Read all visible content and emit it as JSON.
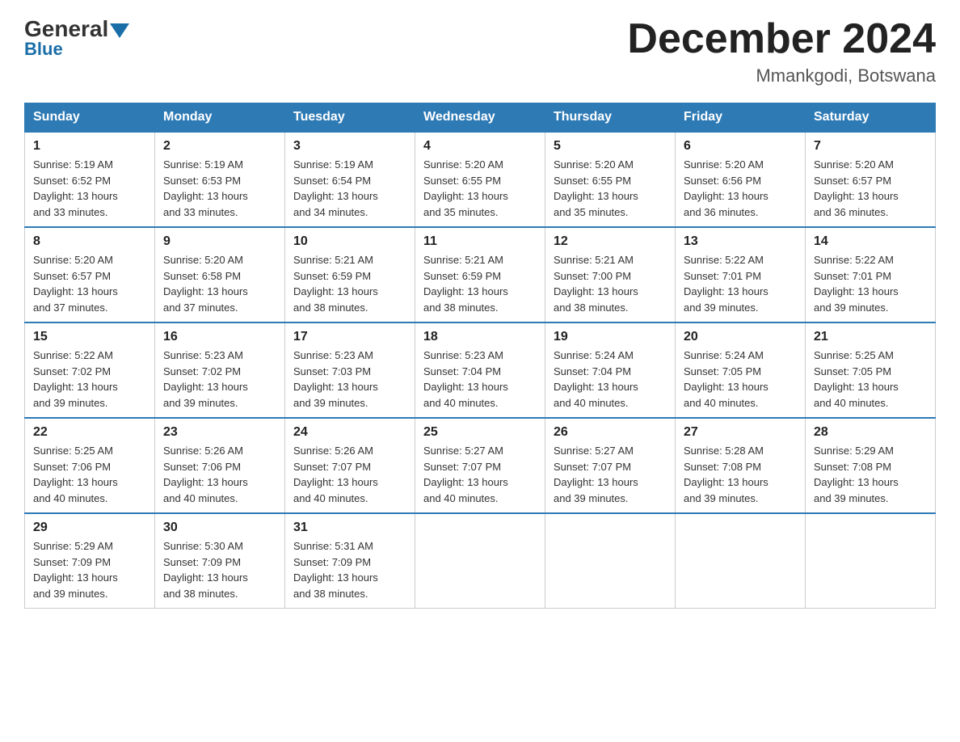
{
  "logo": {
    "general": "General",
    "blue": "Blue"
  },
  "header": {
    "title": "December 2024",
    "subtitle": "Mmankgodi, Botswana"
  },
  "columns": [
    "Sunday",
    "Monday",
    "Tuesday",
    "Wednesday",
    "Thursday",
    "Friday",
    "Saturday"
  ],
  "weeks": [
    [
      {
        "day": "1",
        "info": "Sunrise: 5:19 AM\nSunset: 6:52 PM\nDaylight: 13 hours\nand 33 minutes."
      },
      {
        "day": "2",
        "info": "Sunrise: 5:19 AM\nSunset: 6:53 PM\nDaylight: 13 hours\nand 33 minutes."
      },
      {
        "day": "3",
        "info": "Sunrise: 5:19 AM\nSunset: 6:54 PM\nDaylight: 13 hours\nand 34 minutes."
      },
      {
        "day": "4",
        "info": "Sunrise: 5:20 AM\nSunset: 6:55 PM\nDaylight: 13 hours\nand 35 minutes."
      },
      {
        "day": "5",
        "info": "Sunrise: 5:20 AM\nSunset: 6:55 PM\nDaylight: 13 hours\nand 35 minutes."
      },
      {
        "day": "6",
        "info": "Sunrise: 5:20 AM\nSunset: 6:56 PM\nDaylight: 13 hours\nand 36 minutes."
      },
      {
        "day": "7",
        "info": "Sunrise: 5:20 AM\nSunset: 6:57 PM\nDaylight: 13 hours\nand 36 minutes."
      }
    ],
    [
      {
        "day": "8",
        "info": "Sunrise: 5:20 AM\nSunset: 6:57 PM\nDaylight: 13 hours\nand 37 minutes."
      },
      {
        "day": "9",
        "info": "Sunrise: 5:20 AM\nSunset: 6:58 PM\nDaylight: 13 hours\nand 37 minutes."
      },
      {
        "day": "10",
        "info": "Sunrise: 5:21 AM\nSunset: 6:59 PM\nDaylight: 13 hours\nand 38 minutes."
      },
      {
        "day": "11",
        "info": "Sunrise: 5:21 AM\nSunset: 6:59 PM\nDaylight: 13 hours\nand 38 minutes."
      },
      {
        "day": "12",
        "info": "Sunrise: 5:21 AM\nSunset: 7:00 PM\nDaylight: 13 hours\nand 38 minutes."
      },
      {
        "day": "13",
        "info": "Sunrise: 5:22 AM\nSunset: 7:01 PM\nDaylight: 13 hours\nand 39 minutes."
      },
      {
        "day": "14",
        "info": "Sunrise: 5:22 AM\nSunset: 7:01 PM\nDaylight: 13 hours\nand 39 minutes."
      }
    ],
    [
      {
        "day": "15",
        "info": "Sunrise: 5:22 AM\nSunset: 7:02 PM\nDaylight: 13 hours\nand 39 minutes."
      },
      {
        "day": "16",
        "info": "Sunrise: 5:23 AM\nSunset: 7:02 PM\nDaylight: 13 hours\nand 39 minutes."
      },
      {
        "day": "17",
        "info": "Sunrise: 5:23 AM\nSunset: 7:03 PM\nDaylight: 13 hours\nand 39 minutes."
      },
      {
        "day": "18",
        "info": "Sunrise: 5:23 AM\nSunset: 7:04 PM\nDaylight: 13 hours\nand 40 minutes."
      },
      {
        "day": "19",
        "info": "Sunrise: 5:24 AM\nSunset: 7:04 PM\nDaylight: 13 hours\nand 40 minutes."
      },
      {
        "day": "20",
        "info": "Sunrise: 5:24 AM\nSunset: 7:05 PM\nDaylight: 13 hours\nand 40 minutes."
      },
      {
        "day": "21",
        "info": "Sunrise: 5:25 AM\nSunset: 7:05 PM\nDaylight: 13 hours\nand 40 minutes."
      }
    ],
    [
      {
        "day": "22",
        "info": "Sunrise: 5:25 AM\nSunset: 7:06 PM\nDaylight: 13 hours\nand 40 minutes."
      },
      {
        "day": "23",
        "info": "Sunrise: 5:26 AM\nSunset: 7:06 PM\nDaylight: 13 hours\nand 40 minutes."
      },
      {
        "day": "24",
        "info": "Sunrise: 5:26 AM\nSunset: 7:07 PM\nDaylight: 13 hours\nand 40 minutes."
      },
      {
        "day": "25",
        "info": "Sunrise: 5:27 AM\nSunset: 7:07 PM\nDaylight: 13 hours\nand 40 minutes."
      },
      {
        "day": "26",
        "info": "Sunrise: 5:27 AM\nSunset: 7:07 PM\nDaylight: 13 hours\nand 39 minutes."
      },
      {
        "day": "27",
        "info": "Sunrise: 5:28 AM\nSunset: 7:08 PM\nDaylight: 13 hours\nand 39 minutes."
      },
      {
        "day": "28",
        "info": "Sunrise: 5:29 AM\nSunset: 7:08 PM\nDaylight: 13 hours\nand 39 minutes."
      }
    ],
    [
      {
        "day": "29",
        "info": "Sunrise: 5:29 AM\nSunset: 7:09 PM\nDaylight: 13 hours\nand 39 minutes."
      },
      {
        "day": "30",
        "info": "Sunrise: 5:30 AM\nSunset: 7:09 PM\nDaylight: 13 hours\nand 38 minutes."
      },
      {
        "day": "31",
        "info": "Sunrise: 5:31 AM\nSunset: 7:09 PM\nDaylight: 13 hours\nand 38 minutes."
      },
      null,
      null,
      null,
      null
    ]
  ]
}
